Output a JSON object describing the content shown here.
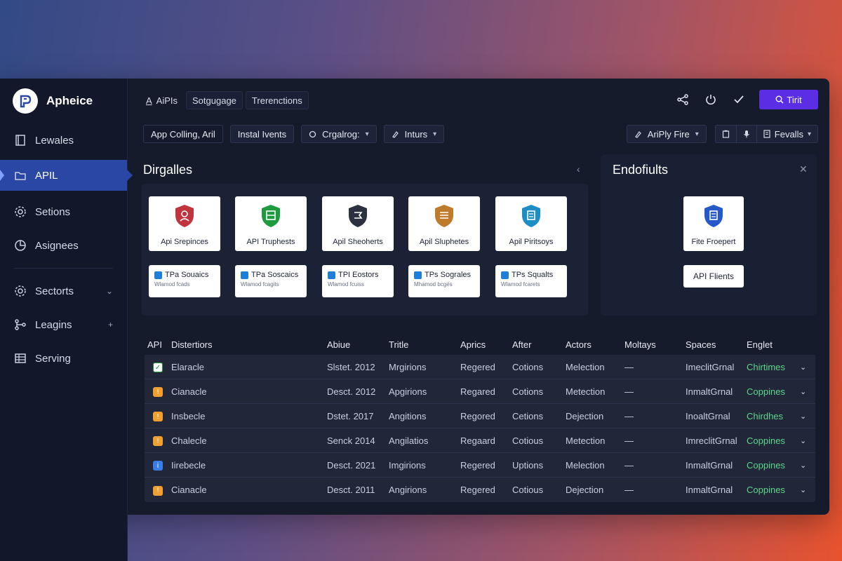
{
  "brand": {
    "name": "Apheice"
  },
  "sidebar": {
    "items": [
      {
        "label": "Lewales",
        "icon": "book-icon"
      },
      {
        "label": "APIL",
        "icon": "folder-icon",
        "active": true
      },
      {
        "label": "Setions",
        "icon": "gear-icon"
      },
      {
        "label": "Asignees",
        "icon": "pie-icon"
      },
      {
        "label": "Sectorts",
        "icon": "gear-icon",
        "trail": "⌄"
      },
      {
        "label": "Leagins",
        "icon": "branch-icon",
        "trail": "+"
      },
      {
        "label": "Serving",
        "icon": "table-icon"
      }
    ]
  },
  "tabs": [
    {
      "label": "AiPIs",
      "icon": "A"
    },
    {
      "label": "Sotgugage"
    },
    {
      "label": "Trerenctions"
    }
  ],
  "topbar": {
    "primary_label": "Tirit"
  },
  "filters": {
    "left": [
      {
        "label": "App Colling, Aril"
      },
      {
        "label": "Instal Ivents"
      },
      {
        "label": "Crgalrog:",
        "dropdown": true
      },
      {
        "label": "Inturs",
        "dropdown": true
      }
    ],
    "right_dropdown": "AriPly Fire",
    "right_group_last": "Fevalls"
  },
  "panels": {
    "left_title": "Dirgalles",
    "right_title": "Endofiults"
  },
  "cards": [
    {
      "label": "Api Srepinces",
      "color": "#c0343e"
    },
    {
      "label": "API Truphests",
      "color": "#1f9b3f"
    },
    {
      "label": "Apil Sheoherts",
      "color": "#2c3140"
    },
    {
      "label": "Apil Sluphetes",
      "color": "#c07a2b"
    },
    {
      "label": "Apil Piritsoys",
      "color": "#1c8ec4"
    }
  ],
  "mini_cards": [
    {
      "title": "TPa Souaics",
      "sub": "Wlamod fcads"
    },
    {
      "title": "TPa Soscaics",
      "sub": "Wlamod fcagits"
    },
    {
      "title": "TPI Eostors",
      "sub": "Wlamod fcuiss"
    },
    {
      "title": "TPs Sograles",
      "sub": "Mhamod bcgés"
    },
    {
      "title": "TPs Squalts",
      "sub": "Wlamod fcarets"
    }
  ],
  "right_cards": {
    "card_label": "Fite Froepert",
    "card_color": "#2558c8",
    "button_label": "API Flients"
  },
  "table": {
    "headers": [
      "API",
      "Distertiors",
      "Abiue",
      "Tritle",
      "Aprics",
      "After",
      "Actors",
      "Moltays",
      "Spaces",
      "Englet"
    ],
    "rows": [
      {
        "status": "ok",
        "name": "Elaracle",
        "date": "Slstet. 2012",
        "title": "Mrgirions",
        "aprics": "Regered",
        "after": "Cotions",
        "actors": "Melection",
        "moltays": "—",
        "spaces": "ImeclitGrnal",
        "englet": "Chirtimes"
      },
      {
        "status": "warn",
        "name": "Cianacle",
        "date": "Desct. 2012",
        "title": "Apgirions",
        "aprics": "Regared",
        "after": "Cotions",
        "actors": "Metection",
        "moltays": "—",
        "spaces": "InmaltGrnal",
        "englet": "Coppines"
      },
      {
        "status": "warn",
        "name": "Insbecle",
        "date": "Dstet. 2017",
        "title": "Angitions",
        "aprics": "Regored",
        "after": "Cetions",
        "actors": "Dejection",
        "moltays": "—",
        "spaces": "InoaltGrnal",
        "englet": "Chirdhes"
      },
      {
        "status": "warn",
        "name": "Chalecle",
        "date": "Senck 2014",
        "title": "Angilatios",
        "aprics": "Regaard",
        "after": "Cotious",
        "actors": "Metection",
        "moltays": "—",
        "spaces": "ImreclitGrnal",
        "englet": "Coppines"
      },
      {
        "status": "info",
        "name": "Iirebecle",
        "date": "Desct. 2021",
        "title": "Imgirions",
        "aprics": "Regered",
        "after": "Uptions",
        "actors": "Melection",
        "moltays": "—",
        "spaces": "InmaltGrnal",
        "englet": "Coppines"
      },
      {
        "status": "warn",
        "name": "Cianacle",
        "date": "Desct. 2011",
        "title": "Angirions",
        "aprics": "Regered",
        "after": "Cotious",
        "actors": "Dejection",
        "moltays": "—",
        "spaces": "InmaltGrnal",
        "englet": "Coppines"
      }
    ]
  },
  "colors": {
    "accent": "#5b2ee6",
    "active_nav": "#2a47a6",
    "positive": "#5dd68a"
  }
}
